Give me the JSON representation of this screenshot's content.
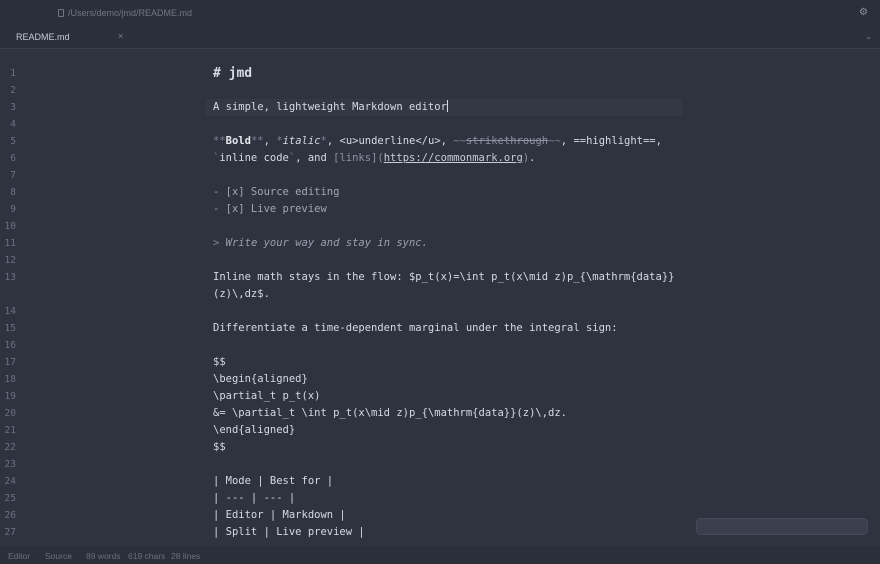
{
  "window": {
    "file_path": "/Users/demo/jmd/README.md",
    "settings_icon": "gear-icon"
  },
  "tabs": [
    {
      "label": "README.md",
      "close_label": "×"
    }
  ],
  "tab_overflow_icon": "chevron-down-icon",
  "editor": {
    "active_line": 3,
    "lines": [
      {
        "n": "1",
        "kind": "h1",
        "parts": [
          {
            "t": "# jmd",
            "c": "h1"
          }
        ]
      },
      {
        "n": "2",
        "kind": "blank",
        "parts": []
      },
      {
        "n": "3",
        "kind": "text",
        "parts": [
          {
            "t": "A simple, lightweight Markdown editor",
            "c": ""
          }
        ]
      },
      {
        "n": "4",
        "kind": "blank",
        "parts": []
      },
      {
        "n": "5",
        "kind": "text",
        "parts": [
          {
            "t": "**",
            "c": "mk"
          },
          {
            "t": "Bold",
            "c": "b"
          },
          {
            "t": "**",
            "c": "mk"
          },
          {
            "t": ", ",
            "c": ""
          },
          {
            "t": "*",
            "c": "mk"
          },
          {
            "t": "italic",
            "c": "i"
          },
          {
            "t": "*",
            "c": "mk"
          },
          {
            "t": ", <u>underline</u>, ",
            "c": ""
          },
          {
            "t": "~~",
            "c": "mk"
          },
          {
            "t": "strikethrough",
            "c": "strike"
          },
          {
            "t": "~~",
            "c": "mk"
          },
          {
            "t": ", ==highlight==,",
            "c": ""
          }
        ]
      },
      {
        "n": "6",
        "kind": "text",
        "parts": [
          {
            "t": "`",
            "c": "mk"
          },
          {
            "t": "inline code",
            "c": ""
          },
          {
            "t": "`",
            "c": "mk"
          },
          {
            "t": ", and ",
            "c": ""
          },
          {
            "t": "[links]",
            "c": "lnk"
          },
          {
            "t": "(",
            "c": "lnk"
          },
          {
            "t": "https://commonmark.org",
            "c": "url"
          },
          {
            "t": ")",
            "c": "lnk"
          },
          {
            "t": ".",
            "c": ""
          }
        ]
      },
      {
        "n": "7",
        "kind": "blank",
        "parts": []
      },
      {
        "n": "8",
        "kind": "text",
        "parts": [
          {
            "t": "- [x] Source editing",
            "c": "task"
          }
        ]
      },
      {
        "n": "9",
        "kind": "text",
        "parts": [
          {
            "t": "- [x] Live preview",
            "c": "task"
          }
        ]
      },
      {
        "n": "10",
        "kind": "blank",
        "parts": []
      },
      {
        "n": "11",
        "kind": "text",
        "parts": [
          {
            "t": "> ",
            "c": "mk"
          },
          {
            "t": "Write your way and stay in sync.",
            "c": "quote"
          }
        ]
      },
      {
        "n": "12",
        "kind": "blank",
        "parts": []
      },
      {
        "n": "13",
        "kind": "text",
        "parts": [
          {
            "t": "Inline math stays in the flow: $p_t(x)=\\int p_t(x\\mid z)p_{\\mathrm{data}}",
            "c": ""
          }
        ]
      },
      {
        "n": "",
        "kind": "wrap",
        "parts": [
          {
            "t": "(z)\\,dz$.",
            "c": ""
          }
        ]
      },
      {
        "n": "14",
        "kind": "blank",
        "parts": []
      },
      {
        "n": "15",
        "kind": "text",
        "parts": [
          {
            "t": "Differentiate a time-dependent marginal under the integral sign:",
            "c": ""
          }
        ]
      },
      {
        "n": "16",
        "kind": "blank",
        "parts": []
      },
      {
        "n": "17",
        "kind": "text",
        "parts": [
          {
            "t": "$$",
            "c": ""
          }
        ]
      },
      {
        "n": "18",
        "kind": "text",
        "parts": [
          {
            "t": "\\begin{aligned}",
            "c": ""
          }
        ]
      },
      {
        "n": "19",
        "kind": "text",
        "parts": [
          {
            "t": "\\partial_t p_t(x)",
            "c": ""
          }
        ]
      },
      {
        "n": "20",
        "kind": "text",
        "parts": [
          {
            "t": "&= \\partial_t \\int p_t(x\\mid z)p_{\\mathrm{data}}(z)\\,dz.",
            "c": ""
          }
        ]
      },
      {
        "n": "21",
        "kind": "text",
        "parts": [
          {
            "t": "\\end{aligned}",
            "c": ""
          }
        ]
      },
      {
        "n": "22",
        "kind": "text",
        "parts": [
          {
            "t": "$$",
            "c": ""
          }
        ]
      },
      {
        "n": "23",
        "kind": "blank",
        "parts": []
      },
      {
        "n": "24",
        "kind": "text",
        "parts": [
          {
            "t": "| Mode | Best for |",
            "c": ""
          }
        ]
      },
      {
        "n": "25",
        "kind": "text",
        "parts": [
          {
            "t": "| --- | --- |",
            "c": ""
          }
        ]
      },
      {
        "n": "26",
        "kind": "text",
        "parts": [
          {
            "t": "| Editor | Markdown |",
            "c": ""
          }
        ]
      },
      {
        "n": "27",
        "kind": "text",
        "parts": [
          {
            "t": "| Split | Live preview |",
            "c": ""
          }
        ]
      }
    ]
  },
  "statusbar": {
    "mode": "Editor",
    "view": "Source",
    "words": "89 words",
    "chars": "619 chars",
    "lines": "28 lines"
  },
  "colors": {
    "background": "#2f3340",
    "chrome": "#2b2f3a",
    "text": "#d7dae0",
    "muted": "#6b7181"
  }
}
